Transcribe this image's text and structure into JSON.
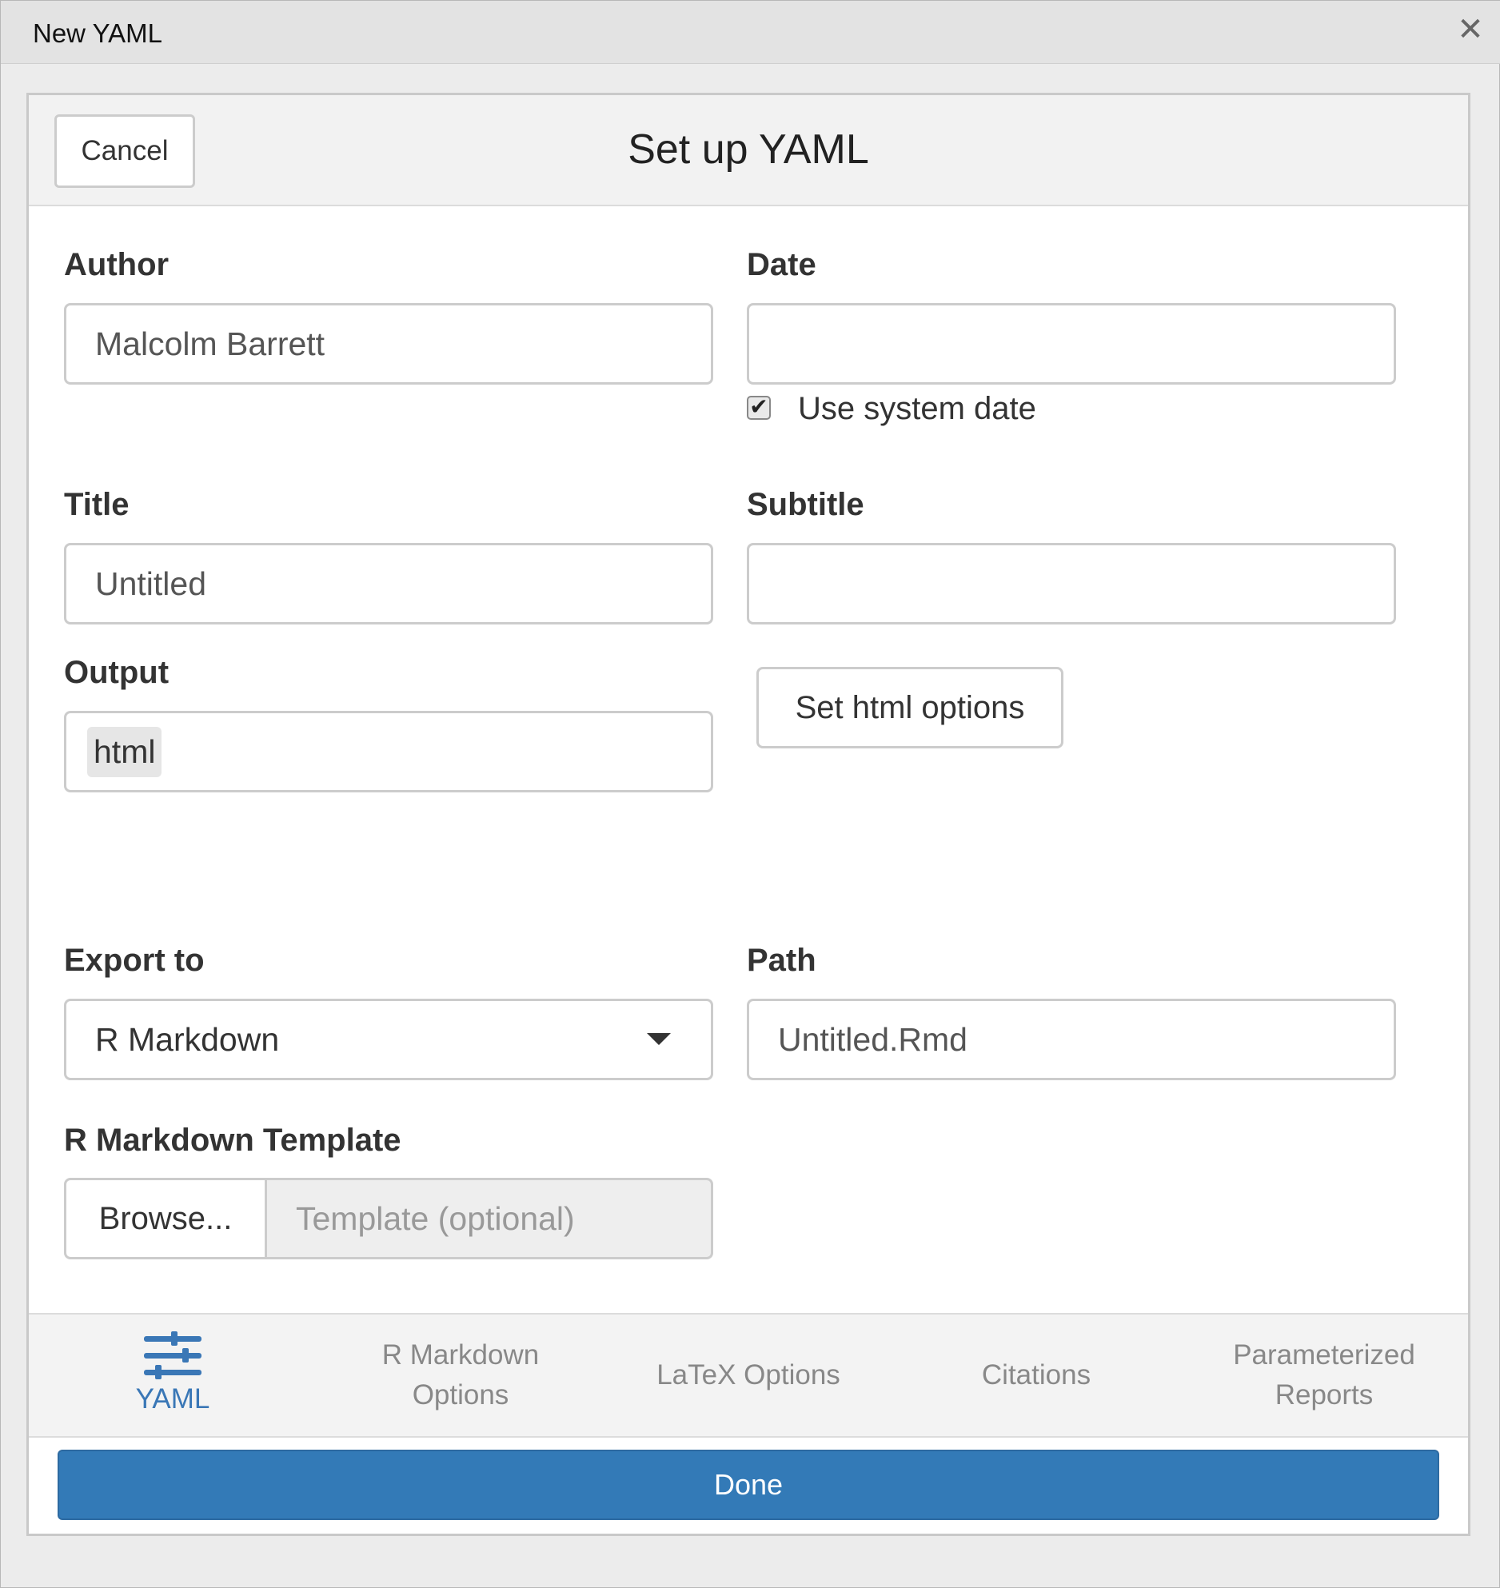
{
  "window": {
    "title": "New YAML"
  },
  "header": {
    "cancel_label": "Cancel",
    "title": "Set up YAML"
  },
  "form": {
    "author": {
      "label": "Author",
      "value": "Malcolm Barrett"
    },
    "date": {
      "label": "Date",
      "value": "",
      "use_system_date_label": "Use system date",
      "use_system_date_checked": true
    },
    "title": {
      "label": "Title",
      "placeholder": "Untitled"
    },
    "subtitle": {
      "label": "Subtitle",
      "value": ""
    },
    "output": {
      "label": "Output",
      "selected": "html",
      "options_button": "Set html options"
    },
    "export_to": {
      "label": "Export to",
      "selected": "R Markdown"
    },
    "path": {
      "label": "Path",
      "placeholder": "Untitled.Rmd"
    },
    "template": {
      "label": "R Markdown Template",
      "browse_label": "Browse...",
      "placeholder": "Template (optional)"
    }
  },
  "tabs": [
    {
      "line1": "YAML",
      "line2": "",
      "icon": "sliders-icon",
      "active": true
    },
    {
      "line1": "R Markdown",
      "line2": "Options",
      "active": false
    },
    {
      "line1": "LaTeX Options",
      "line2": "",
      "active": false
    },
    {
      "line1": "Citations",
      "line2": "",
      "active": false
    },
    {
      "line1": "Parameterized",
      "line2": "Reports",
      "active": false
    }
  ],
  "footer": {
    "done_label": "Done"
  },
  "colors": {
    "accent": "#337ab7",
    "active_tab": "#3a77b6"
  }
}
